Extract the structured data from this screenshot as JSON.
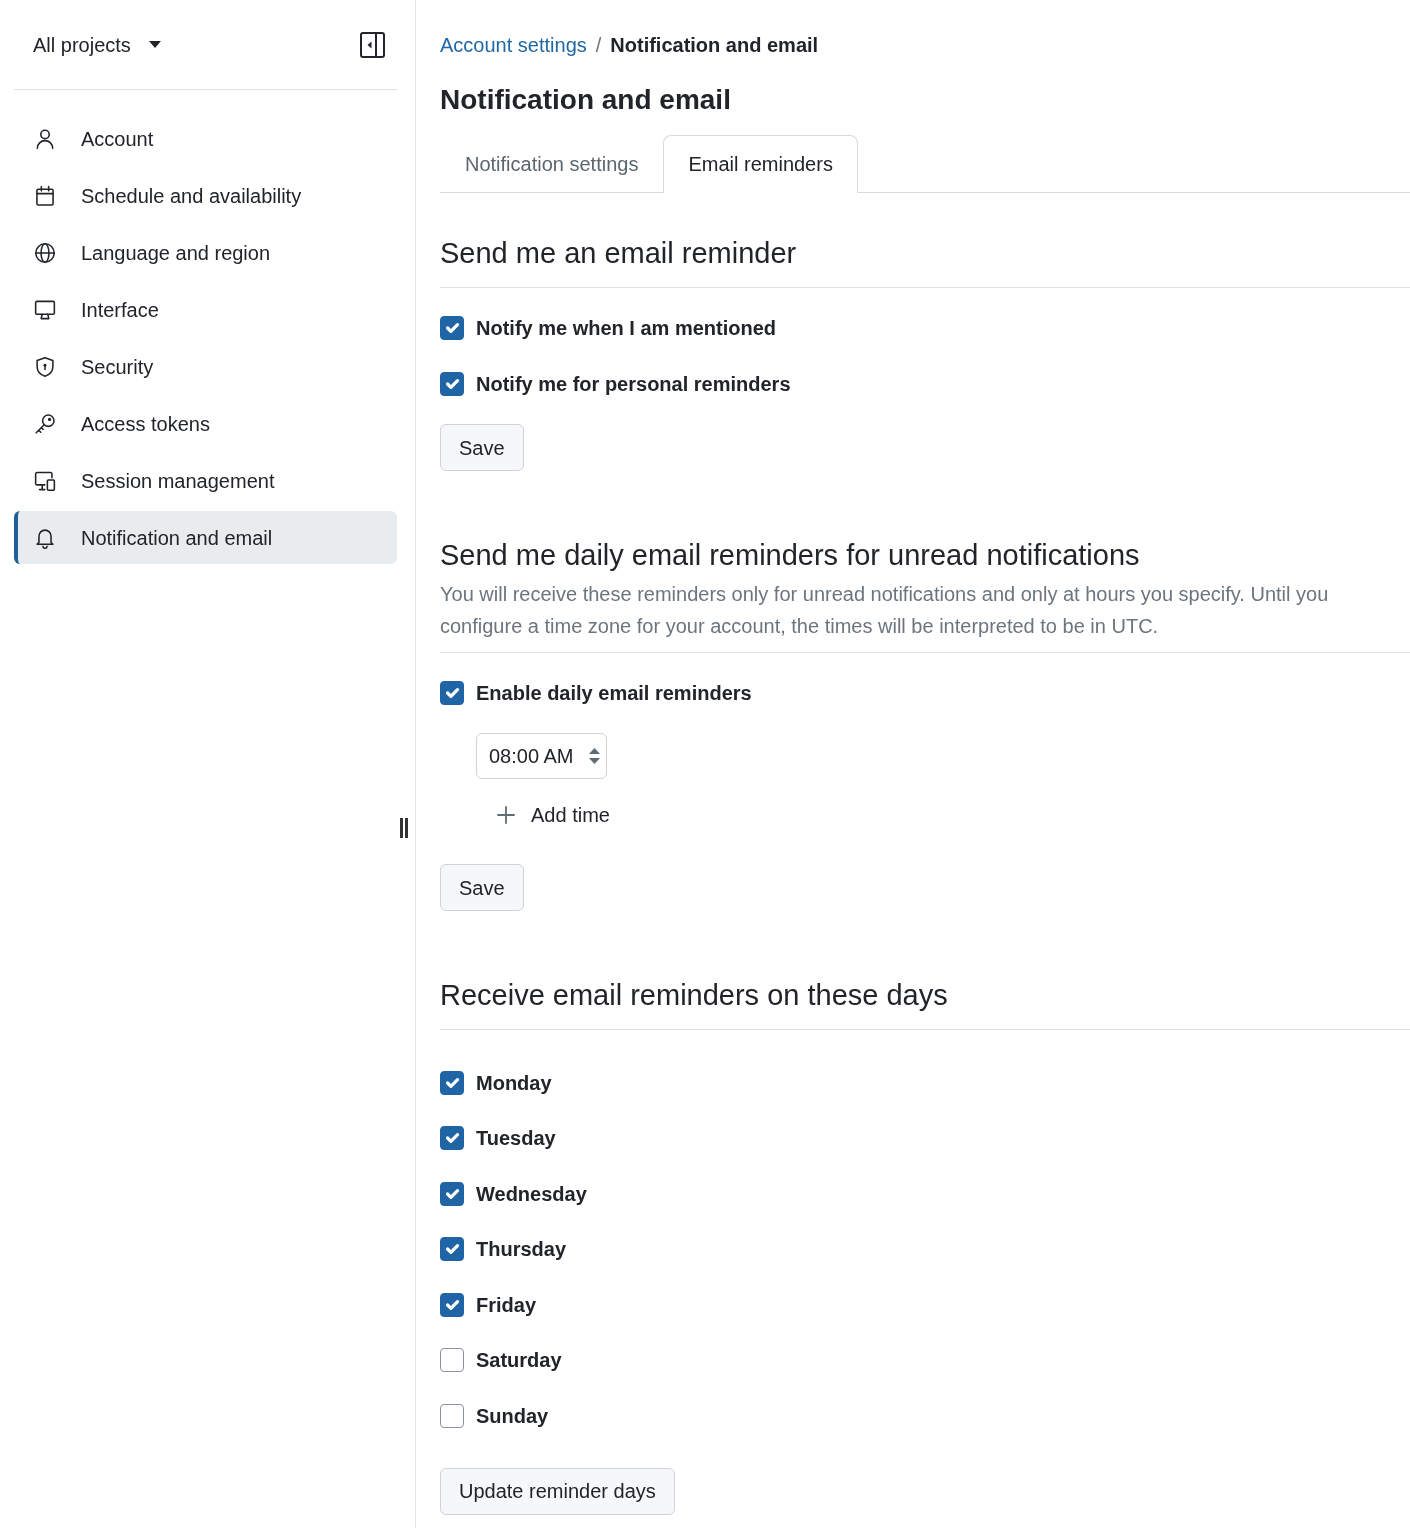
{
  "sidebar": {
    "project_selector": "All projects",
    "items": [
      {
        "label": "Account",
        "selected": false
      },
      {
        "label": "Schedule and availability",
        "selected": false
      },
      {
        "label": "Language and region",
        "selected": false
      },
      {
        "label": "Interface",
        "selected": false
      },
      {
        "label": "Security",
        "selected": false
      },
      {
        "label": "Access tokens",
        "selected": false
      },
      {
        "label": "Session management",
        "selected": false
      },
      {
        "label": "Notification and email",
        "selected": true
      }
    ]
  },
  "breadcrumb": {
    "parent": "Account settings",
    "separator": "/",
    "current": "Notification and email"
  },
  "page_title": "Notification and email",
  "tabs": [
    {
      "label": "Notification settings",
      "selected": false
    },
    {
      "label": "Email reminders",
      "selected": true
    }
  ],
  "sections": [
    {
      "kind": "options",
      "title": "Send me an email reminder",
      "options": [
        {
          "label": "Notify me when I am mentioned",
          "checked": true
        },
        {
          "label": "Notify me for personal reminders",
          "checked": true
        }
      ],
      "button": "Save"
    },
    {
      "kind": "schedule",
      "title": "Send me daily email reminders for unread notifications",
      "description": "You will receive these reminders only for unread notifications and only at hours you specify. Until you configure a time zone for your account, the times will be interpreted to be in UTC.",
      "options": [
        {
          "label": "Enable daily email reminders",
          "checked": true
        }
      ],
      "times": [
        "08:00 AM"
      ],
      "add_time": "Add time",
      "button": "Save"
    },
    {
      "kind": "days",
      "title": "Receive email reminders on these days",
      "options": [
        {
          "label": "Monday",
          "checked": true
        },
        {
          "label": "Tuesday",
          "checked": true
        },
        {
          "label": "Wednesday",
          "checked": true
        },
        {
          "label": "Thursday",
          "checked": true
        },
        {
          "label": "Friday",
          "checked": true
        },
        {
          "label": "Saturday",
          "checked": false
        },
        {
          "label": "Sunday",
          "checked": false
        }
      ],
      "button": "Update reminder days"
    }
  ]
}
